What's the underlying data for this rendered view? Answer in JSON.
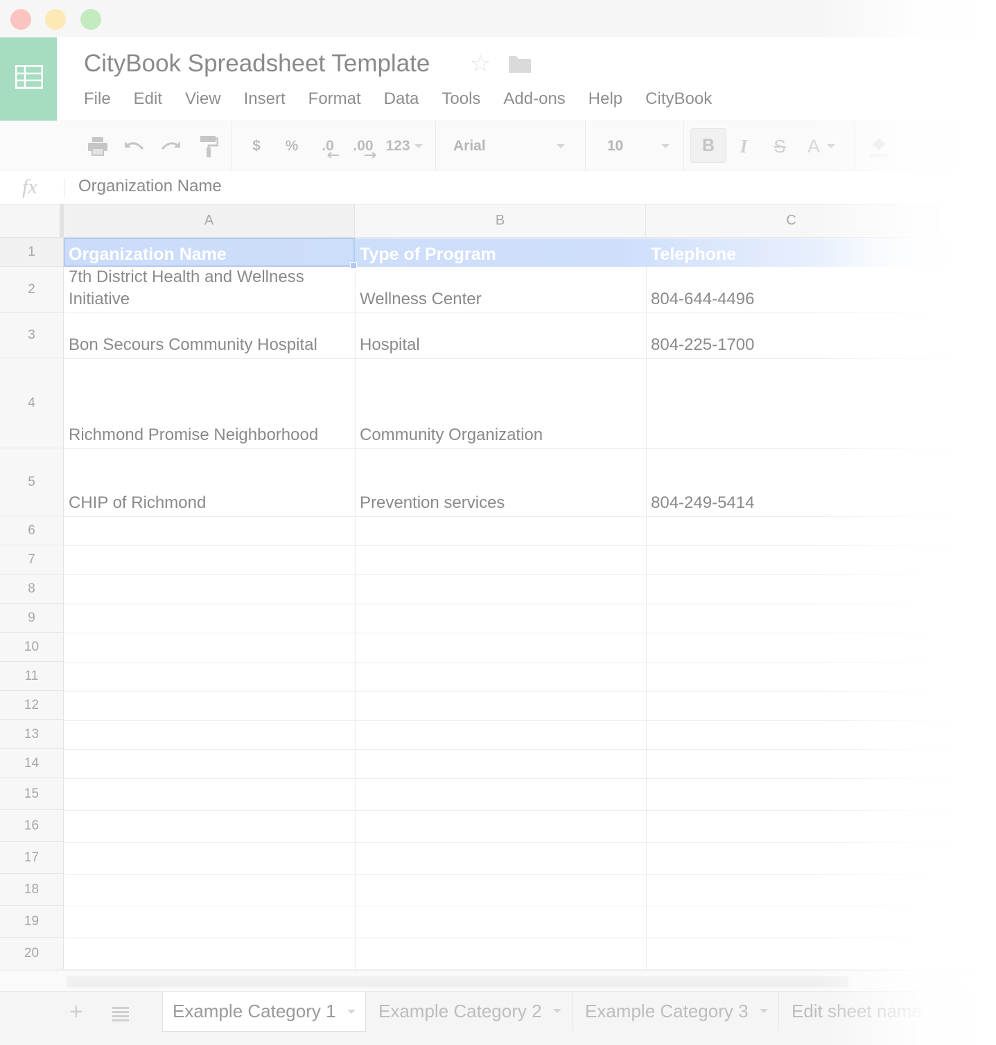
{
  "document": {
    "title": "CityBook Spreadsheet Template"
  },
  "menu": [
    "File",
    "Edit",
    "View",
    "Insert",
    "Format",
    "Data",
    "Tools",
    "Add-ons",
    "Help",
    "CityBook"
  ],
  "toolbar": {
    "currency": "$",
    "percent": "%",
    "decrease_decimal": ".0",
    "increase_decimal": ".00",
    "more_formats": "123",
    "font": "Arial",
    "font_size": "10",
    "bold": "B",
    "italic": "I",
    "strikethrough": "S",
    "text_color": "A"
  },
  "formula_bar": {
    "fx": "fx",
    "value": "Organization Name"
  },
  "columns": [
    "A",
    "B",
    "C"
  ],
  "rows": [
    "1",
    "2",
    "3",
    "4",
    "5",
    "6",
    "7",
    "8",
    "9",
    "10",
    "11",
    "12",
    "13",
    "14",
    "15",
    "16",
    "17",
    "18",
    "19",
    "20"
  ],
  "cells": {
    "r1": [
      "Organization Name",
      "Type of Program",
      "Telephone"
    ],
    "r2": [
      "7th District Health and Wellness Initiative",
      "Wellness Center",
      "804-644-4496"
    ],
    "r3": [
      "Bon Secours Community Hospital",
      "Hospital",
      "804-225-1700"
    ],
    "r4": [
      "Richmond Promise Neighborhood",
      "Community Organization",
      ""
    ],
    "r5": [
      "CHIP of Richmond",
      "Prevention services",
      "804-249-5414"
    ]
  },
  "sheets": [
    "Example Category 1",
    "Example Category 2",
    "Example Category 3",
    "Edit sheet name"
  ],
  "colors": {
    "header_fill": "#cfdffb",
    "logo": "#a6dcc0",
    "selection": "#b3c9f5"
  }
}
